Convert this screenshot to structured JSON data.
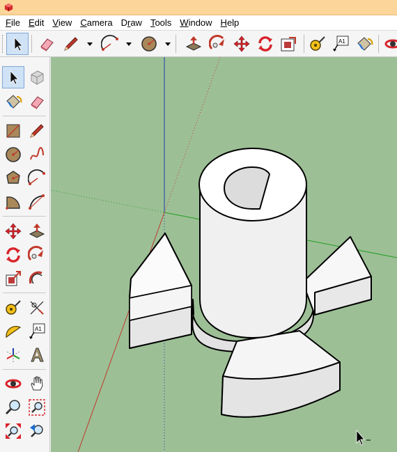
{
  "app": {
    "name": "SketchUp",
    "icon": "sketchup-logo-icon",
    "titlebar_color": "#fcd59a"
  },
  "menubar": {
    "items": [
      {
        "label": "File",
        "accel": "F"
      },
      {
        "label": "Edit",
        "accel": "E"
      },
      {
        "label": "View",
        "accel": "V"
      },
      {
        "label": "Camera",
        "accel": "C"
      },
      {
        "label": "Draw",
        "accel": "r"
      },
      {
        "label": "Tools",
        "accel": "T"
      },
      {
        "label": "Window",
        "accel": "W"
      },
      {
        "label": "Help",
        "accel": "H"
      }
    ]
  },
  "toolbar": {
    "buttons": [
      {
        "icon": "select-arrow-icon",
        "active": true
      },
      {
        "icon": "eraser-icon"
      },
      {
        "icon": "pencil-line-icon",
        "dropdown": true
      },
      {
        "icon": "arc-icon",
        "dropdown": true
      },
      {
        "icon": "circle-icon",
        "dropdown": true
      },
      {
        "icon": "push-pull-icon"
      },
      {
        "icon": "follow-me-icon"
      },
      {
        "icon": "move-icon"
      },
      {
        "icon": "rotate-icon"
      },
      {
        "icon": "offset-icon"
      },
      {
        "icon": "tape-measure-icon"
      },
      {
        "icon": "text-label-icon",
        "text": "A1"
      },
      {
        "icon": "paint-bucket-icon"
      },
      {
        "icon": "orbit-icon"
      }
    ]
  },
  "left_toolbar": {
    "buttons": [
      {
        "icon": "select-arrow-icon",
        "active": true
      },
      {
        "icon": "make-component-icon"
      },
      {
        "icon": "paint-bucket-icon"
      },
      {
        "icon": "eraser-icon"
      },
      {
        "icon": "rectangle-icon"
      },
      {
        "icon": "line-pencil-icon"
      },
      {
        "icon": "circle-icon"
      },
      {
        "icon": "freehand-icon"
      },
      {
        "icon": "polygon-icon"
      },
      {
        "icon": "arc-icon"
      },
      {
        "icon": "pie-icon"
      },
      {
        "icon": "two-point-arc-icon"
      },
      {
        "icon": "move-icon"
      },
      {
        "icon": "push-pull-icon"
      },
      {
        "icon": "rotate-icon"
      },
      {
        "icon": "follow-me-icon"
      },
      {
        "icon": "scale-icon"
      },
      {
        "icon": "offset-icon"
      },
      {
        "icon": "tape-measure-icon"
      },
      {
        "icon": "dimension-icon"
      },
      {
        "icon": "protractor-icon"
      },
      {
        "icon": "text-label-icon",
        "text": "A1"
      },
      {
        "icon": "axes-icon"
      },
      {
        "icon": "3d-text-icon"
      },
      {
        "icon": "orbit-icon"
      },
      {
        "icon": "pan-hand-icon"
      },
      {
        "icon": "zoom-icon"
      },
      {
        "icon": "zoom-window-icon"
      },
      {
        "icon": "zoom-extents-icon"
      },
      {
        "icon": "previous-view-icon"
      }
    ]
  },
  "viewport": {
    "background": "#9dbf96",
    "model": "cylindrical hub with three flanges",
    "axes": {
      "red": "#c0392b",
      "green": "#1f9e1f",
      "blue": "#1a3fa8"
    },
    "cursor": "select-arrow-icon"
  }
}
